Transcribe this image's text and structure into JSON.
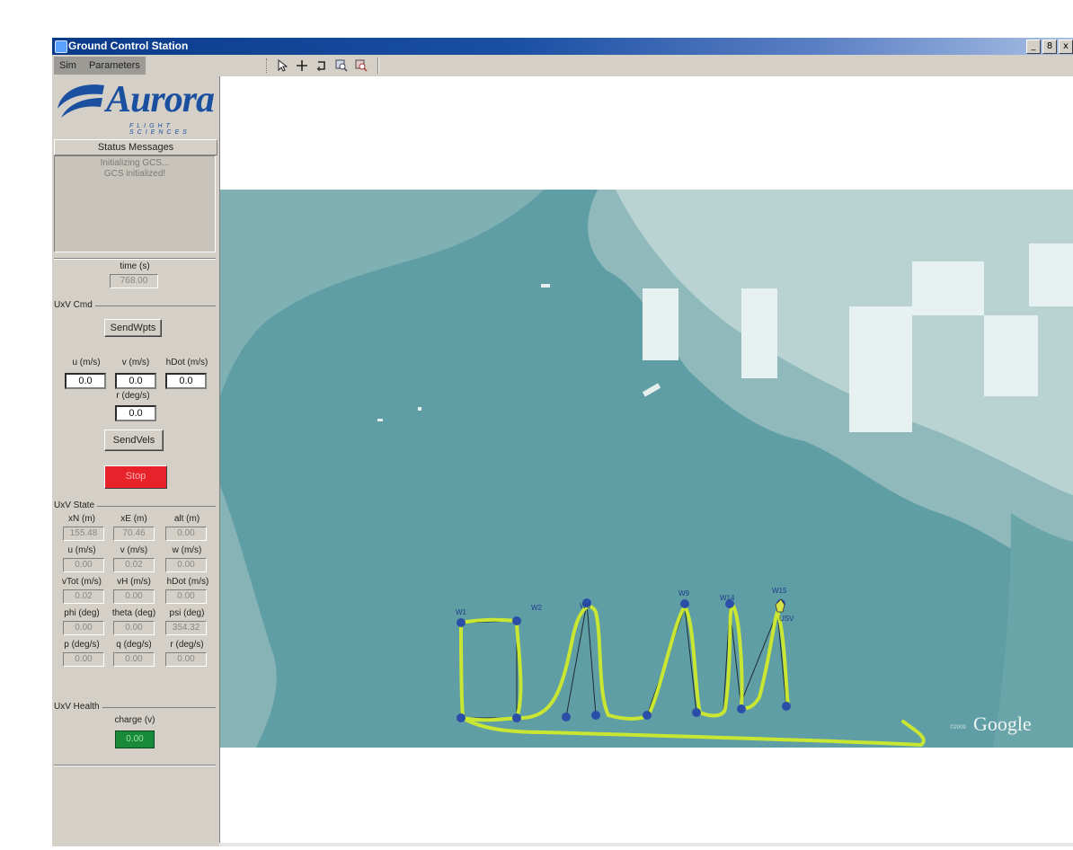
{
  "window": {
    "title": "Ground Control Station",
    "controls": [
      "_",
      "8",
      "x"
    ]
  },
  "menu": {
    "items": [
      "Sim",
      "Parameters"
    ]
  },
  "toolbar": {
    "tools": [
      "select-arrow-icon",
      "crosshair-icon",
      "rotate-icon",
      "zoom-in-icon",
      "zoom-out-icon"
    ]
  },
  "logo": {
    "name": "Aurora",
    "tagline": "FLIGHT SCIENCES"
  },
  "status": {
    "title": "Status Messages",
    "messages": [
      "Initializing GCS...",
      "GCS initialized!"
    ]
  },
  "time": {
    "label": "time (s)",
    "value": "768.00"
  },
  "uxv_cmd": {
    "group_label": "UxV Cmd",
    "send_wpts_label": "SendWpts",
    "u_label": "u (m/s)",
    "v_label": "v (m/s)",
    "hdot_label": "hDot (m/s)",
    "u_value": "0.0",
    "v_value": "0.0",
    "hdot_value": "0.0",
    "r_label": "r (deg/s)",
    "r_value": "0.0",
    "send_vels_label": "SendVels",
    "stop_label": "Stop"
  },
  "uxv_state": {
    "group_label": "UxV State",
    "rows": [
      {
        "labels": [
          "xN (m)",
          "xE (m)",
          "alt (m)"
        ],
        "values": [
          "155.48",
          "70.46",
          "0.00"
        ]
      },
      {
        "labels": [
          "u (m/s)",
          "v (m/s)",
          "w (m/s)"
        ],
        "values": [
          "0.00",
          "0.02",
          "0.00"
        ]
      },
      {
        "labels": [
          "vTot (m/s)",
          "vH (m/s)",
          "hDot (m/s)"
        ],
        "values": [
          "0.02",
          "0.00",
          "0.00"
        ]
      },
      {
        "labels": [
          "phi (deg)",
          "theta (deg)",
          "psi (deg)"
        ],
        "values": [
          "0.00",
          "0.00",
          "354.32"
        ]
      },
      {
        "labels": [
          "p (deg/s)",
          "q (deg/s)",
          "r (deg/s)"
        ],
        "values": [
          "0.00",
          "0.00",
          "0.00"
        ]
      }
    ]
  },
  "uxv_health": {
    "group_label": "UxV Health",
    "charge_label": "charge (v)",
    "charge_value": "0.00"
  },
  "map": {
    "waypoints_top": [
      "W1",
      "W2",
      "W6",
      "W9",
      "W14",
      "W15"
    ],
    "vehicle_label": "USV",
    "attribution": "Google",
    "attribution_prefix": "©2009",
    "path_color": "#c8e632",
    "water_color": "#5f9ea4"
  }
}
